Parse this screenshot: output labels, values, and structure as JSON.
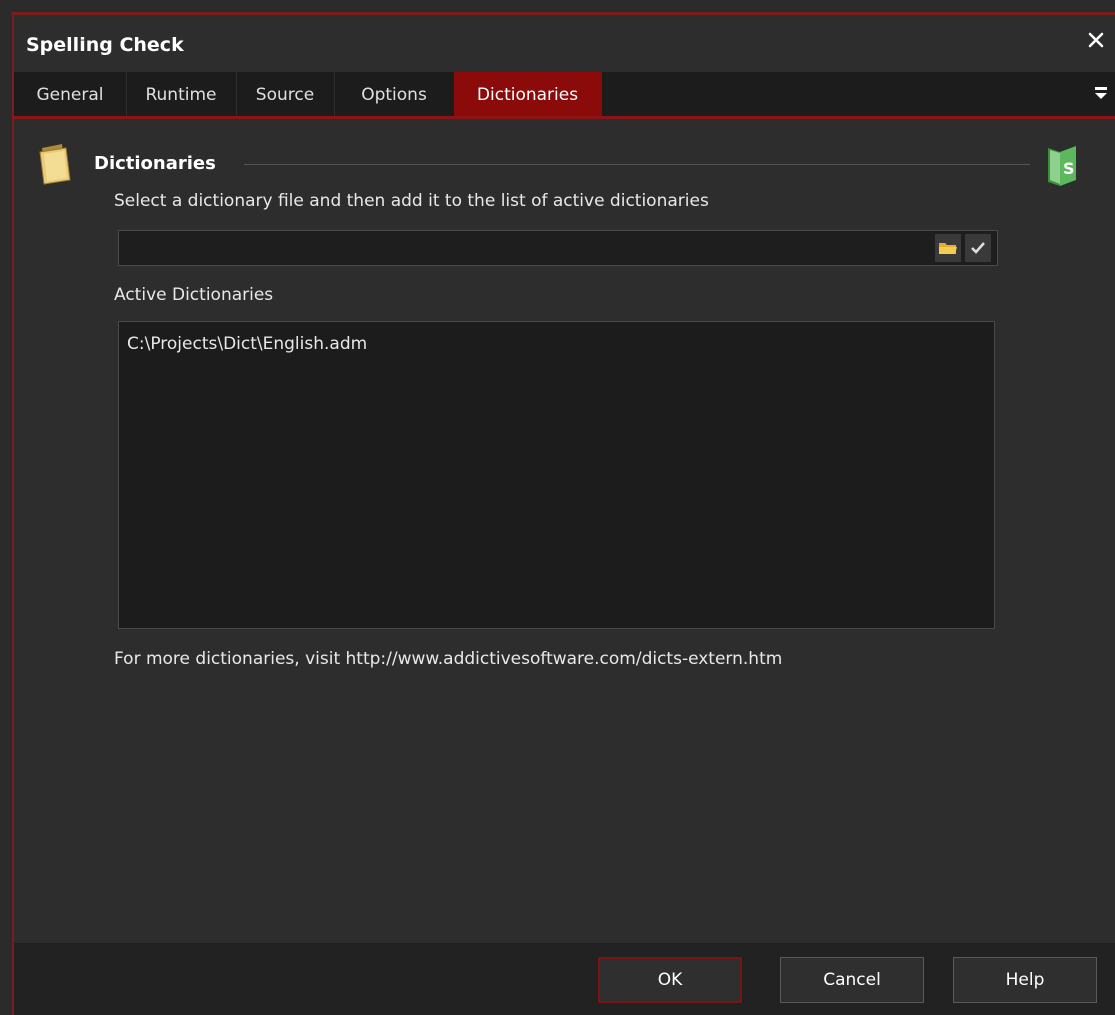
{
  "window": {
    "title": "Spelling Check"
  },
  "tabs": [
    {
      "label": "General"
    },
    {
      "label": "Runtime"
    },
    {
      "label": "Source"
    },
    {
      "label": "Options"
    },
    {
      "label": "Dictionaries"
    }
  ],
  "active_tab": "Dictionaries",
  "section": {
    "title": "Dictionaries",
    "instruction": "Select a dictionary file and then add it to the list of active dictionaries",
    "file_input": {
      "value": "",
      "placeholder": ""
    },
    "active_label": "Active Dictionaries",
    "active_dictionaries": [
      "C:\\Projects\\Dict\\English.adm"
    ],
    "footer_note": "For more dictionaries, visit http://www.addictivesoftware.com/dicts-extern.htm"
  },
  "buttons": {
    "ok": "OK",
    "cancel": "Cancel",
    "help": "Help"
  },
  "colors": {
    "accent": "#8b0a0a",
    "background": "#2d2d2d",
    "field": "#1e1e1e"
  },
  "icons": [
    "close-icon",
    "overflow-menu-icon",
    "folder-icon",
    "spellcheck-book-icon",
    "browse-folder-icon",
    "checkmark-icon"
  ]
}
